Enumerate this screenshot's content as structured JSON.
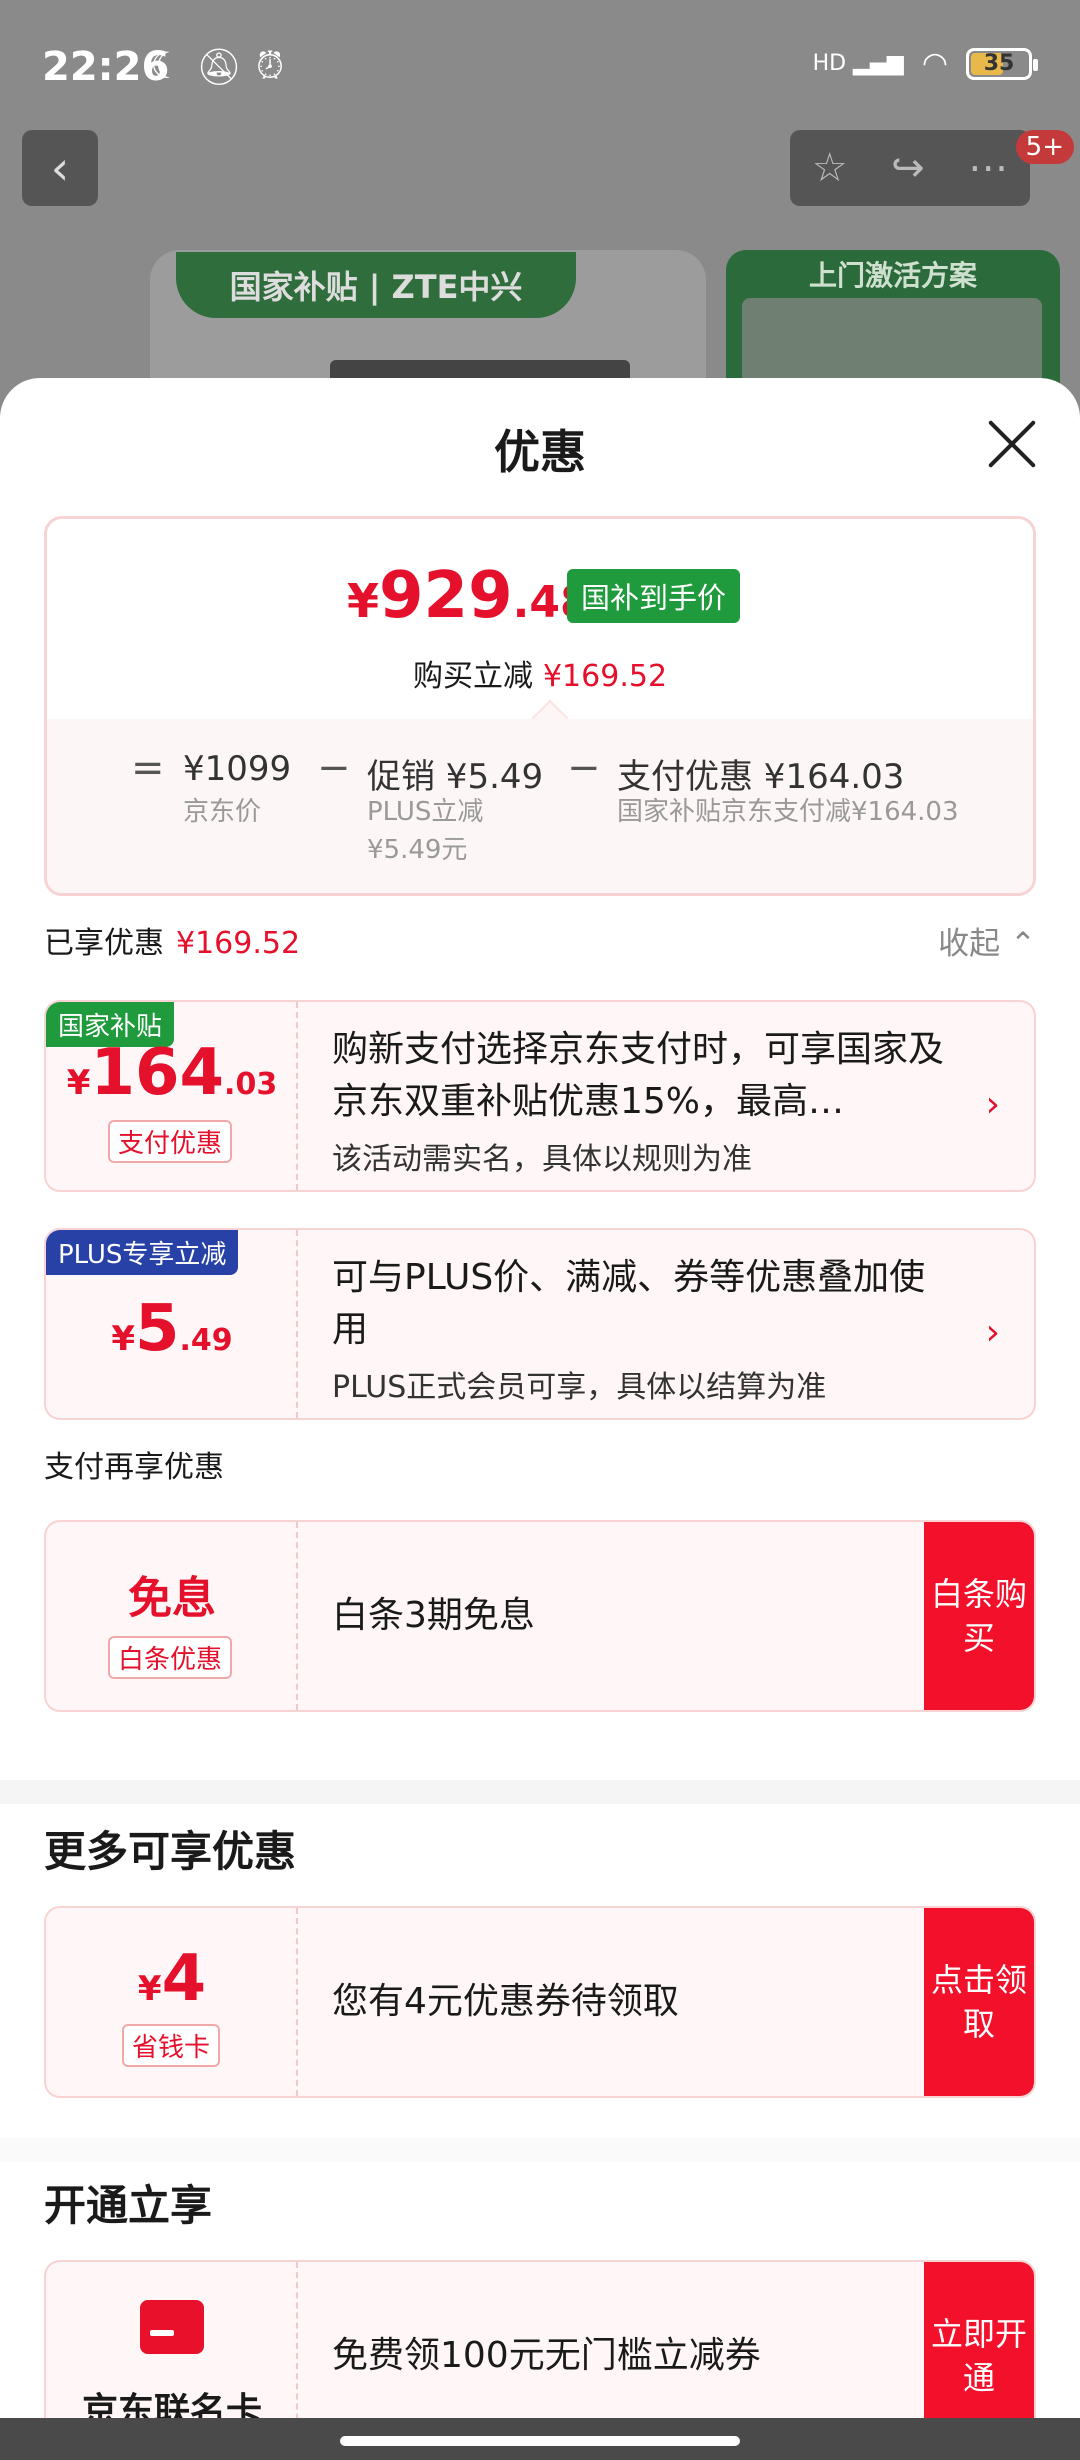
{
  "status": {
    "time": "22:26",
    "battery": "35",
    "network": "HD"
  },
  "background": {
    "banner_text": "国家补贴 | ZTE中兴",
    "side_card_title": "上门激活方案",
    "badge_count": "5+"
  },
  "sheet": {
    "title": "优惠",
    "price": {
      "yen": "¥",
      "integer": "929",
      "decimal": ".48",
      "tag": "国补到手价",
      "reduce_label": "购买立减",
      "reduce_amount": "¥169.52"
    },
    "breakdown": {
      "eq": "=",
      "jd_price": "¥1099",
      "jd_price_label": "京东价",
      "minus1": "−",
      "promo": "促销 ¥5.49",
      "promo_sub1": "PLUS立减",
      "promo_sub2": "¥5.49元",
      "minus2": "−",
      "pay": "支付优惠 ¥164.03",
      "pay_sub": "国家补贴京东支付减¥164.03"
    },
    "enjoyed": {
      "label": "已享优惠",
      "amount": "¥169.52",
      "collapse": "收起 ⌃"
    },
    "coupons": [
      {
        "tag": "国家补贴",
        "yen": "¥",
        "int": "164",
        "dec": ".03",
        "sublabel": "支付优惠",
        "text": "购新支付选择京东支付时，可享国家及京东双重补贴优惠15%，最高…",
        "subtext": "该活动需实名，具体以规则为准"
      },
      {
        "tag": "PLUS专享立减",
        "yen": "¥",
        "int": "5",
        "dec": ".49",
        "text": "可与PLUS价、满减、券等优惠叠加使用",
        "subtext": "PLUS正式会员可享，具体以结算为准"
      }
    ],
    "pay_more": {
      "title": "支付再享优惠",
      "label": "免息",
      "sublabel": "白条优惠",
      "text": "白条3期免息",
      "cta": "白条购买"
    },
    "more": {
      "title": "更多可享优惠",
      "yen": "¥",
      "int": "4",
      "sublabel": "省钱卡",
      "text": "您有4元优惠券待领取",
      "cta": "点击领取"
    },
    "open": {
      "title": "开通立享",
      "label": "京东联名卡",
      "text": "免费领100元无门槛立减券",
      "cta": "立即开通"
    }
  }
}
